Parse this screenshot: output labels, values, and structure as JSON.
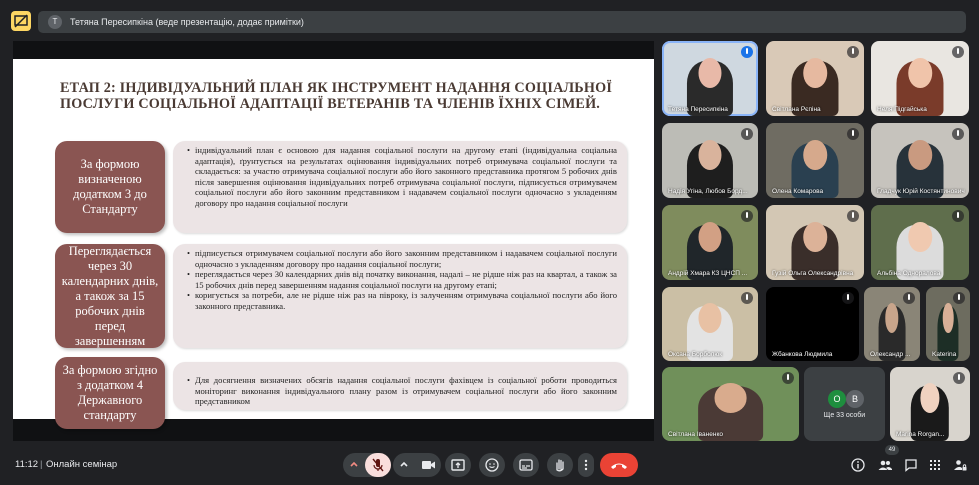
{
  "presenter_bar": {
    "avatar_letter": "T",
    "text": "Тетяна Пересипкіна (веде презентацію, додає примітки)"
  },
  "slide": {
    "title": "ЕТАП 2: ІНДИВІДУАЛЬНИЙ ПЛАН ЯК ІНСТРУМЕНТ НАДАННЯ СОЦІАЛЬНОЇ ПОСЛУГИ СОЦІАЛЬНОЇ АДАПТАЦІЇ ВЕТЕРАНІВ ТА ЧЛЕНІВ ЇХНІХ СІМЕЙ.",
    "rows": [
      {
        "label": "За формою визначеною додатком 3 до Стандарту",
        "bullets": [
          "індивідуальний план є основою для надання соціальної послуги на другому етапі (індивідуальна соціальна адаптація), ґрунтується на результатах оцінювання індивідуальних потреб отримувача соціальної послуги та складається: за участю отримувача соціальної послуги або його законного представника протягом 5 робочих днів після завершення оцінювання індивідуальних потреб отримувача соціальної послуги, підписується отримувачем соціальної послуги або його законним представником і надавачем соціальної послуги одночасно з укладенням договору про надання соціальної послуги"
        ]
      },
      {
        "label": "Переглядається через 30 календарних днів, а також за 15 робочих днів перед завершенням",
        "bullets": [
          "підписується отримувачем соціальної послуги або його законним представником і надавачем соціальної послуги одночасно з укладенням договору про надання соціальної послуги;",
          "переглядається через 30 календарних днів від початку виконання, надалі – не рідше ніж раз на квартал, а також за 15 робочих днів перед завершенням надання соціальної послуги на другому етапі;",
          "коригується за потреби, але не рідше ніж раз на півроку, із залученням отримувача соціальної послуги або його законного представника."
        ]
      },
      {
        "label": "За формою згідно з додатком 4 Державного стандарту",
        "bullets": [
          "Для досягнення визначених обсягів надання соціальної послуги фахівцем із соціальної роботи проводиться моніторинг виконання індивідуального плану разом із отримувачем соціальної послуги або його законним представником"
        ]
      }
    ]
  },
  "participants": [
    {
      "name": "Тетяна Пересипкіна",
      "active": true
    },
    {
      "name": "Світлана Рєпіна"
    },
    {
      "name": "Неля Підгайська"
    },
    {
      "name": "Надія Угіна, Любов Борд..."
    },
    {
      "name": "Олена Комарова"
    },
    {
      "name": "Гладчук Юрій Костянтинович"
    },
    {
      "name": "Андрій Хмара КЗ ЦНСП ..."
    },
    {
      "name": "Гузій Ольга Олександрівна"
    },
    {
      "name": "Альбіна Одноралова"
    },
    {
      "name": "Оксана Борболюк"
    },
    {
      "name": "Жбанкова Людмила"
    },
    {
      "name": "Олександр ..."
    },
    {
      "name": "Katerina"
    },
    {
      "name": "Світлана Іваненко"
    },
    {
      "name": "Marina Rorgan..."
    }
  ],
  "others_tile": {
    "avatars": [
      "О",
      "В"
    ],
    "label": "Ще 33 особи"
  },
  "bottom": {
    "time": "11:12",
    "separator": "|",
    "meeting_name": "Онлайн семінар",
    "people_count": "49"
  },
  "colors": {
    "accent_yellow": "#fdd663",
    "end_call_red": "#ea4335",
    "mic_off_pink": "#f9dedc",
    "slide_label_bg": "#8a5552",
    "slide_text_bg": "#ece4e5"
  }
}
